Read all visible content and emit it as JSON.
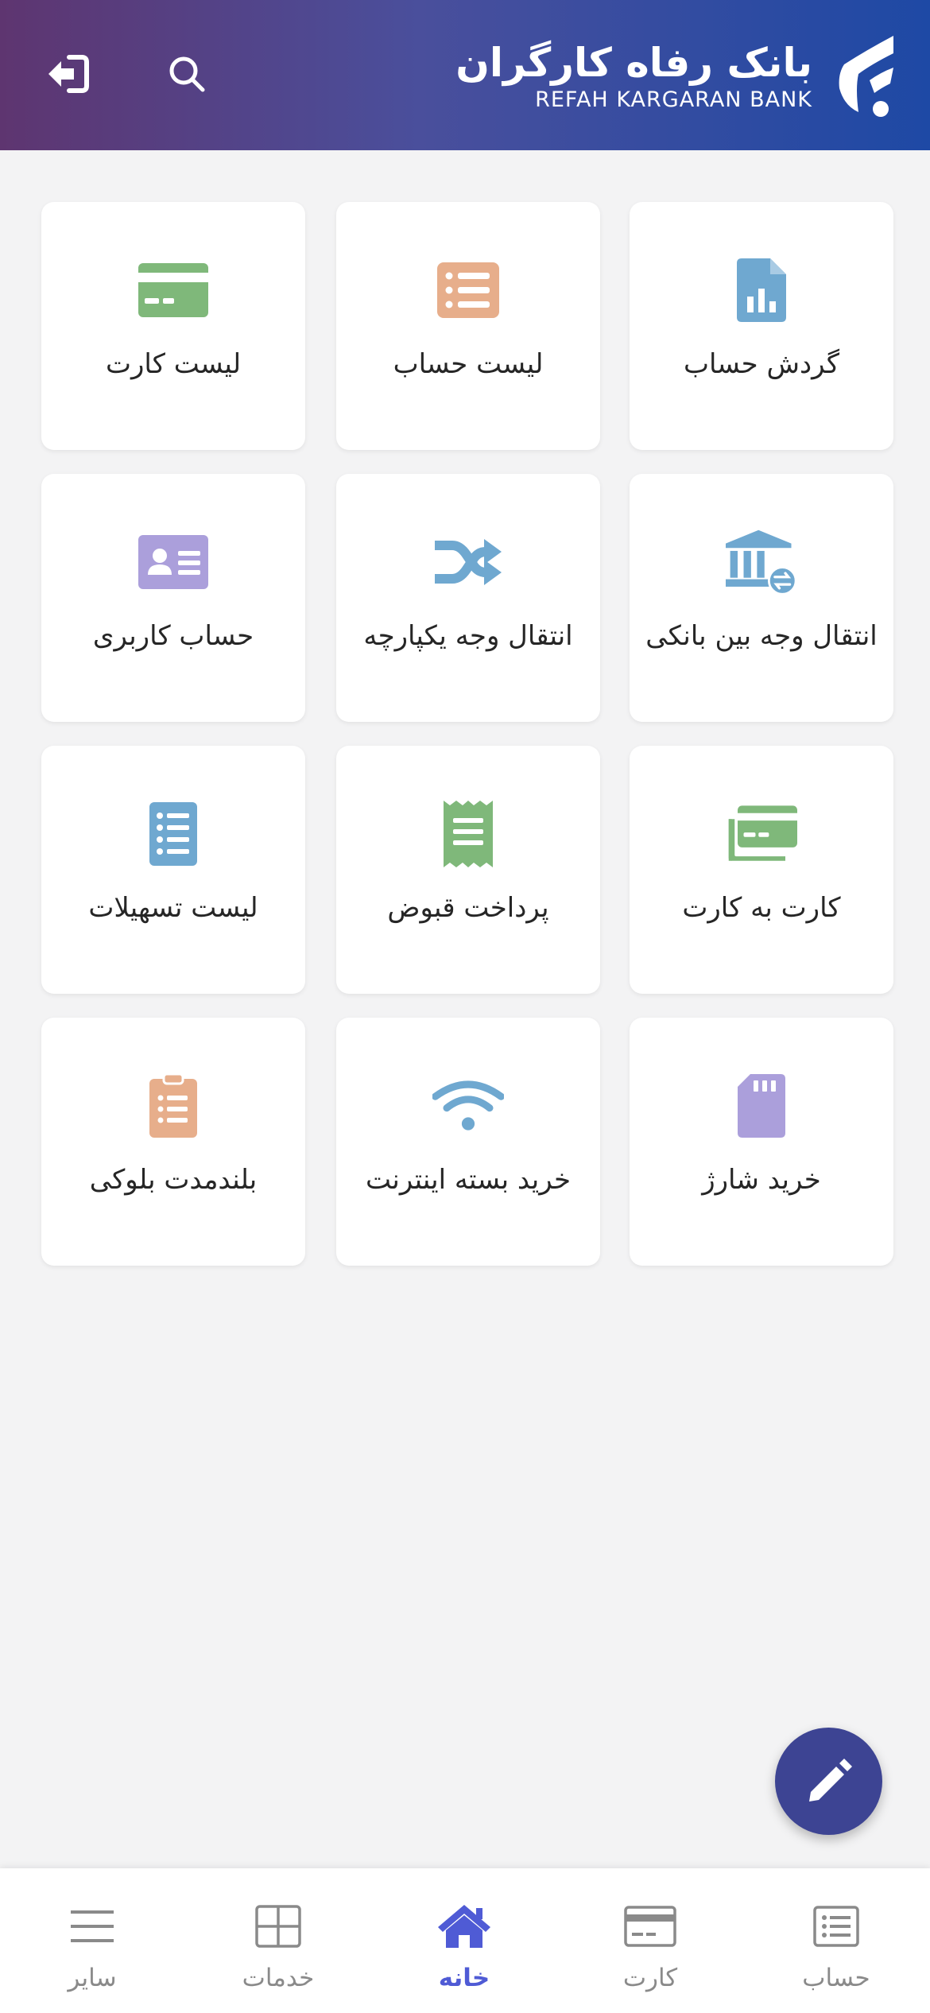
{
  "header": {
    "bank_name_fa": "بانک رفاه کارگران",
    "bank_name_en": "REFAH KARGARAN BANK",
    "search_icon": "search-icon",
    "logout_icon": "logout-icon"
  },
  "tiles": [
    {
      "label": "گردش حساب",
      "icon": "account-statement-icon",
      "color": "#6fa8d0"
    },
    {
      "label": "لیست حساب",
      "icon": "account-list-icon",
      "color": "#e7ae8b"
    },
    {
      "label": "لیست کارت",
      "icon": "card-list-icon",
      "color": "#7fb87a"
    },
    {
      "label": "انتقال وجه بین بانکی",
      "icon": "interbank-transfer-icon",
      "color": "#6fa8d0"
    },
    {
      "label": "انتقال وجه یکپارچه",
      "icon": "integrated-transfer-icon",
      "color": "#6fa8d0"
    },
    {
      "label": "حساب کاربری",
      "icon": "user-account-icon",
      "color": "#ab9fdb"
    },
    {
      "label": "کارت به کارت",
      "icon": "card-to-card-icon",
      "color": "#7fb87a"
    },
    {
      "label": "پرداخت قبوض",
      "icon": "bill-payment-icon",
      "color": "#7fb87a"
    },
    {
      "label": "لیست تسهیلات",
      "icon": "loan-list-icon",
      "color": "#6fa8d0"
    },
    {
      "label": "خرید شارژ",
      "icon": "sim-charge-icon",
      "color": "#ab9fdb"
    },
    {
      "label": "خرید بسته اینترنت",
      "icon": "wifi-icon",
      "color": "#6fa8d0"
    },
    {
      "label": "بلندمدت بلوکی",
      "icon": "clipboard-icon",
      "color": "#e7ae8b"
    }
  ],
  "fab": {
    "icon": "pencil-icon",
    "color": "#3d4493"
  },
  "bottom_nav": [
    {
      "label": "حساب",
      "icon": "account-nav-icon"
    },
    {
      "label": "کارت",
      "icon": "card-nav-icon"
    },
    {
      "label": "خانه",
      "icon": "home-icon",
      "active": true,
      "color": "#4f5bd5"
    },
    {
      "label": "خدمات",
      "icon": "services-grid-icon"
    },
    {
      "label": "سایر",
      "icon": "menu-icon"
    }
  ]
}
